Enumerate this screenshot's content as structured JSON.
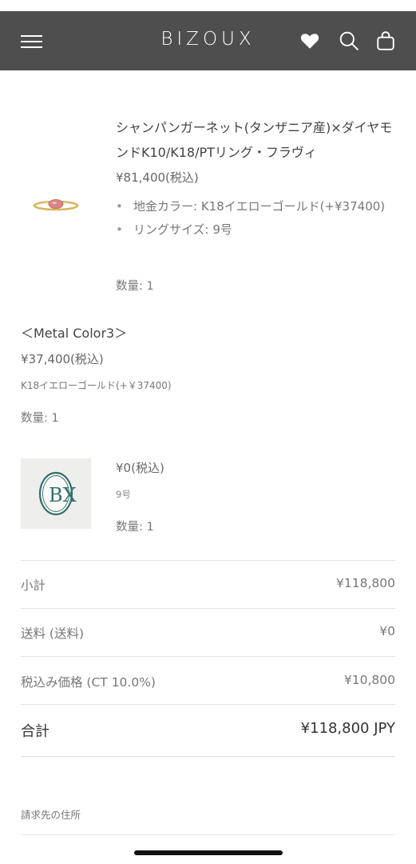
{
  "header": {
    "brand": "BIZOUX",
    "icons": [
      "menu-icon",
      "heart-icon",
      "search-icon",
      "bag-icon"
    ],
    "background": "#4e4e4e"
  },
  "items": [
    {
      "title": "シャンパンガーネット(タンザニア産)×ダイヤモンドK10/K18/PTリング・フラヴィ",
      "price": "¥81,400(税込)",
      "properties": [
        "地金カラー: K18イエローゴールド(+¥37400)",
        "リングサイズ: 9号"
      ],
      "quantity": "数量: 1"
    },
    {
      "name": "＜Metal Color3＞",
      "price": "¥37,400(税込)",
      "variant": "K18イエローゴールド(+￥37400)",
      "quantity": "数量: 1"
    },
    {
      "logo_text": "BX",
      "price": "¥0(税込)",
      "variant": "9号",
      "quantity": "数量: 1"
    }
  ],
  "summary": {
    "subtotal_label": "小計",
    "subtotal_value": "¥118,800",
    "shipping_label": "送料 (送料)",
    "shipping_value": "¥0",
    "tax_label": "税込み価格 (CT 10.0%)",
    "tax_value": "¥10,800",
    "total_label": "合計",
    "total_value": "¥118,800 JPY"
  },
  "billing": {
    "label": "請求先の住所"
  },
  "colors": {
    "logo_teal": "#2f6f6a",
    "gold": "#d9b45a",
    "gem": "#d8848b"
  }
}
